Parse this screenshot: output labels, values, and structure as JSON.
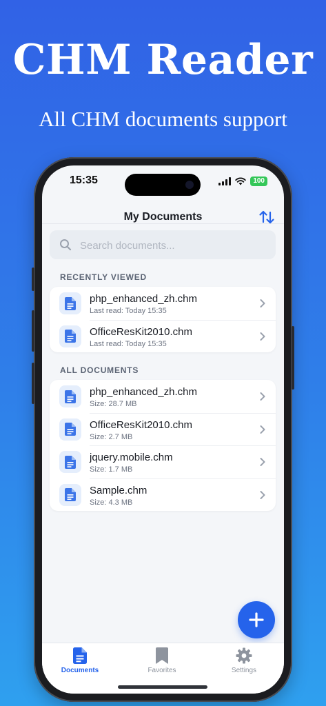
{
  "promo": {
    "headline": "CHM Reader",
    "subline": "All CHM documents support"
  },
  "status_bar": {
    "time": "15:35",
    "battery": "100"
  },
  "navbar": {
    "title": "My Documents",
    "sort_icon": "sort-arrows-icon"
  },
  "search": {
    "placeholder": "Search documents..."
  },
  "recently_viewed": {
    "title": "RECENTLY VIEWED",
    "items": [
      {
        "name": "php_enhanced_zh.chm",
        "meta": "Last read: Today 15:35"
      },
      {
        "name": "OfficeResKit2010.chm",
        "meta": "Last read: Today 15:35"
      }
    ]
  },
  "all_documents": {
    "title": "ALL DOCUMENTS",
    "items": [
      {
        "name": "php_enhanced_zh.chm",
        "meta": "Size: 28.7 MB"
      },
      {
        "name": "OfficeResKit2010.chm",
        "meta": "Size: 2.7 MB"
      },
      {
        "name": "jquery.mobile.chm",
        "meta": "Size: 1.7 MB"
      },
      {
        "name": "Sample.chm",
        "meta": "Size: 4.3 MB"
      }
    ]
  },
  "fab": {
    "icon": "plus-icon"
  },
  "tabbar": {
    "tabs": [
      {
        "label": "Documents",
        "icon": "document-icon",
        "active": true
      },
      {
        "label": "Favorites",
        "icon": "bookmark-icon",
        "active": false
      },
      {
        "label": "Settings",
        "icon": "gear-icon",
        "active": false
      }
    ]
  },
  "colors": {
    "accent": "#2563eb",
    "inactive": "#8e949e",
    "battery": "#34c759"
  }
}
